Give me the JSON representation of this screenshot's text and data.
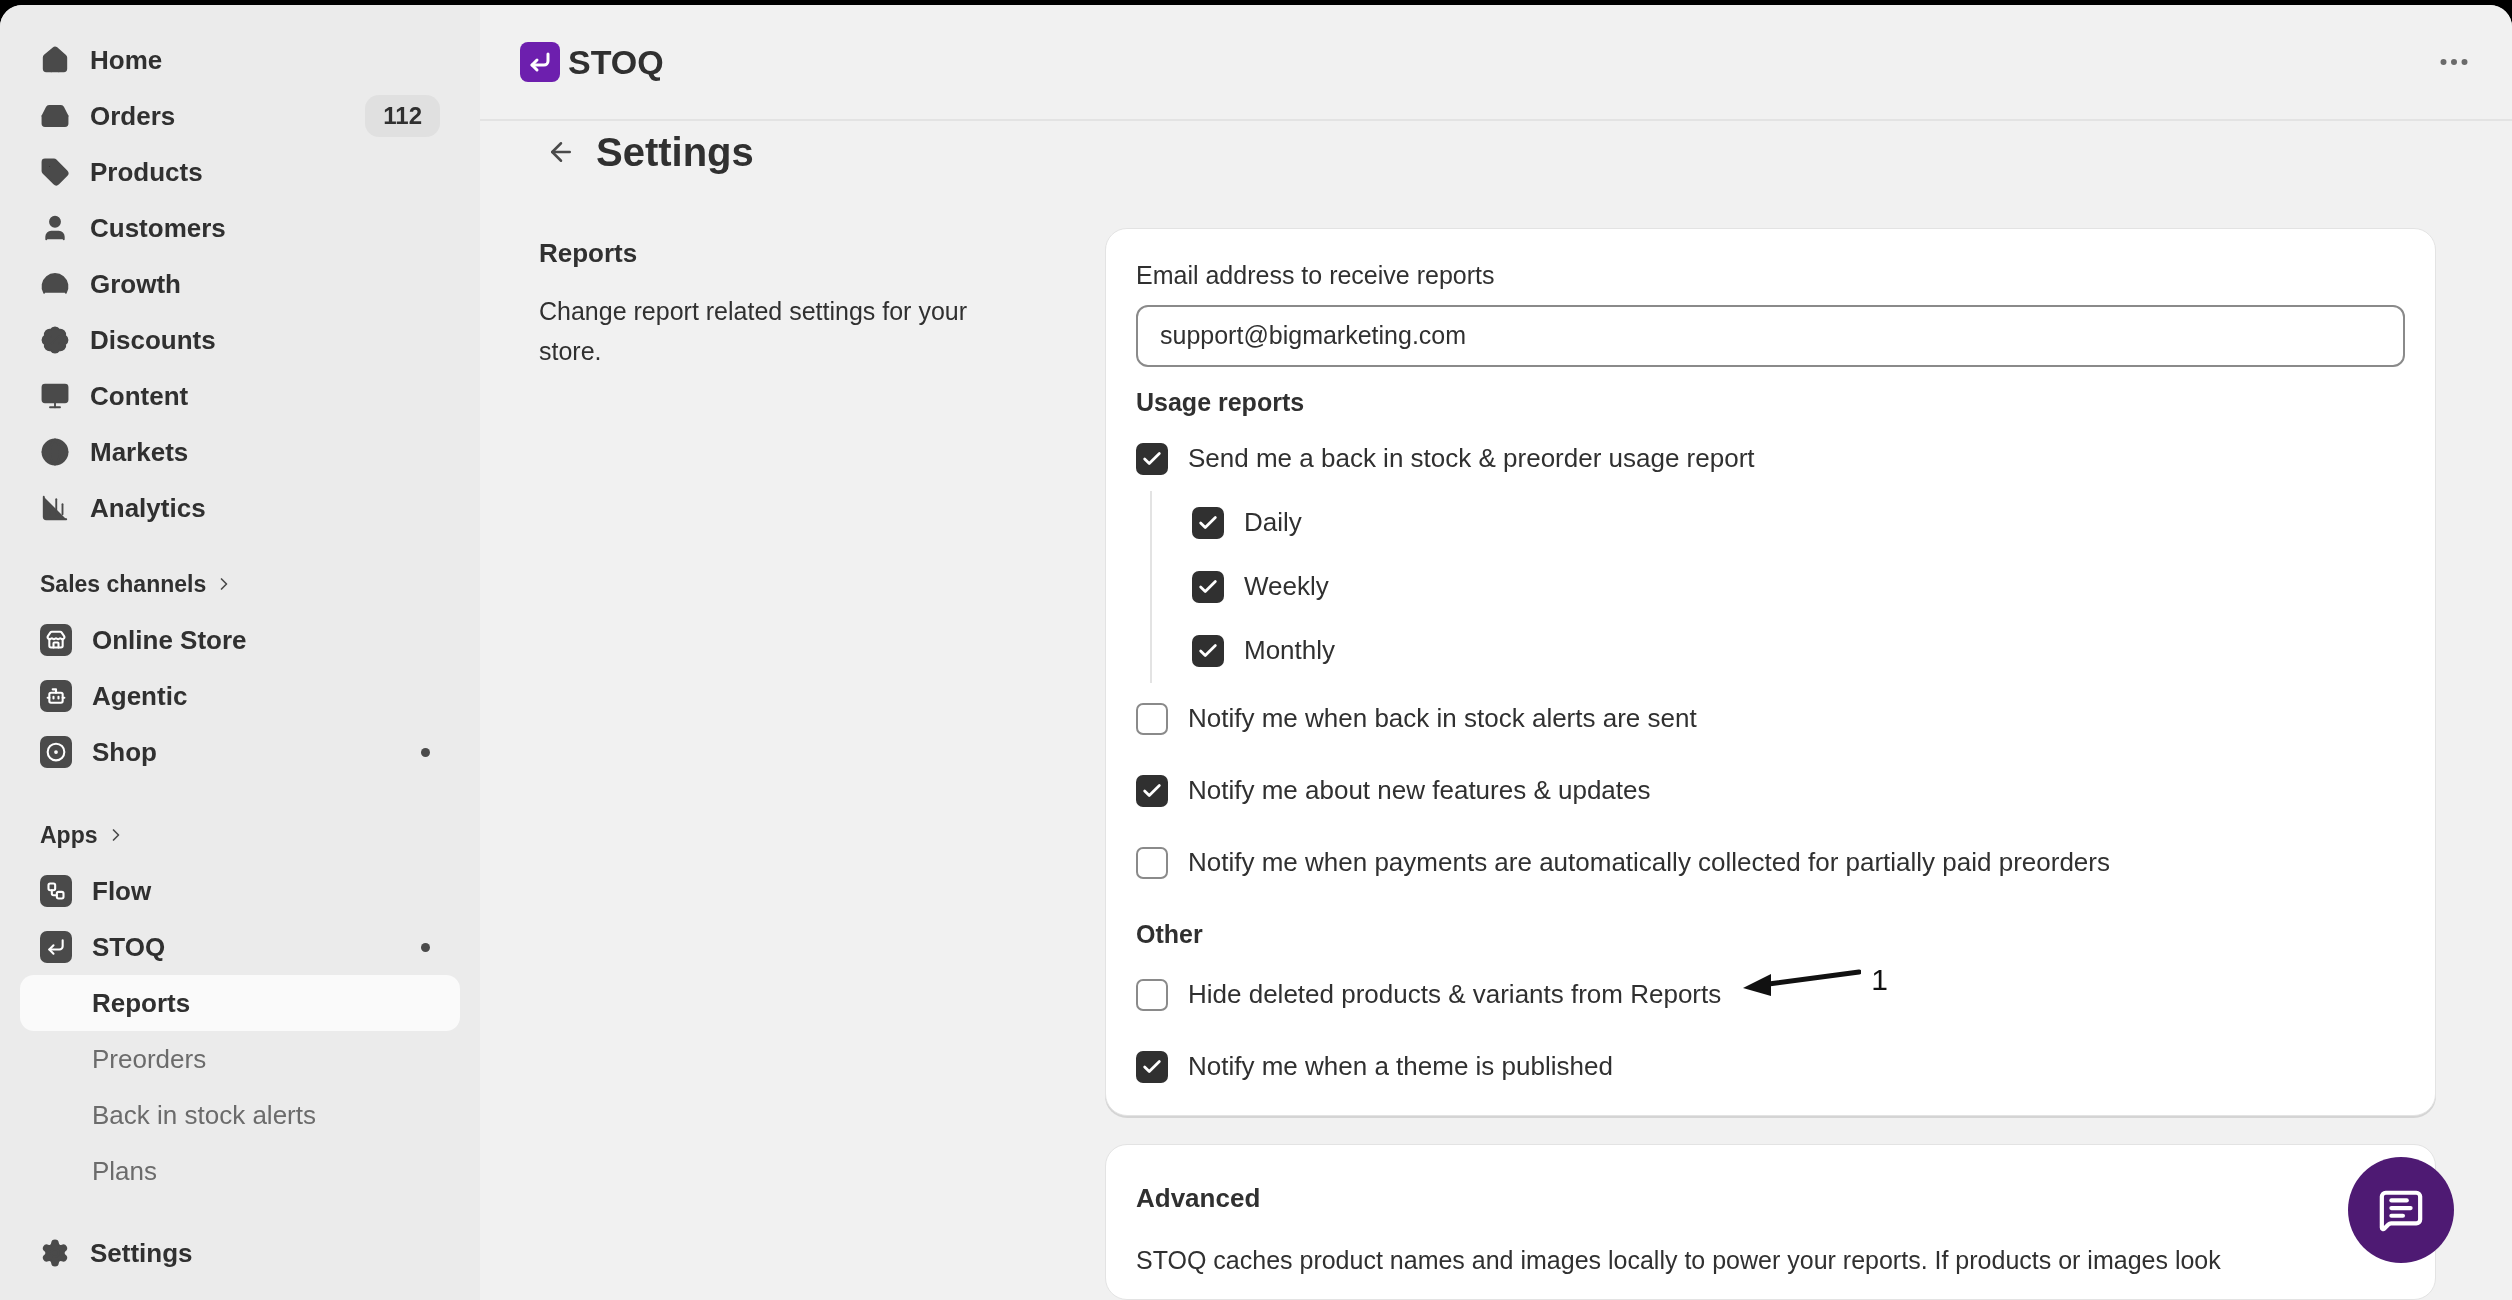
{
  "sidebar": {
    "main_items": [
      {
        "label": "Home"
      },
      {
        "label": "Orders",
        "badge": "112"
      },
      {
        "label": "Products"
      },
      {
        "label": "Customers"
      },
      {
        "label": "Growth"
      },
      {
        "label": "Discounts"
      },
      {
        "label": "Content"
      },
      {
        "label": "Markets"
      },
      {
        "label": "Analytics"
      }
    ],
    "sales_channels": {
      "title": "Sales channels",
      "items": [
        {
          "label": "Online Store",
          "dot": false
        },
        {
          "label": "Agentic",
          "dot": false
        },
        {
          "label": "Shop",
          "dot": true
        }
      ]
    },
    "apps": {
      "title": "Apps",
      "items": [
        {
          "label": "Flow",
          "dot": false
        },
        {
          "label": "STOQ",
          "dot": true,
          "children": [
            {
              "label": "Reports",
              "selected": true
            },
            {
              "label": "Preorders",
              "selected": false
            },
            {
              "label": "Back in stock alerts",
              "selected": false
            },
            {
              "label": "Plans",
              "selected": false
            }
          ]
        }
      ]
    },
    "settings_item": {
      "label": "Settings"
    }
  },
  "header": {
    "app_name": "STOQ"
  },
  "page": {
    "title": "Settings",
    "section": {
      "title": "Reports",
      "description": "Change report related settings for your store."
    },
    "email": {
      "label": "Email address to receive reports",
      "value": "support@bigmarketing.com"
    },
    "groups": [
      {
        "title": "Usage reports",
        "options": [
          {
            "label": "Send me a back in stock & preorder usage report",
            "checked": true,
            "children": [
              {
                "label": "Daily",
                "checked": true
              },
              {
                "label": "Weekly",
                "checked": true
              },
              {
                "label": "Monthly",
                "checked": true
              }
            ]
          },
          {
            "label": "Notify me when back in stock alerts are sent",
            "checked": false
          },
          {
            "label": "Notify me about new features & updates",
            "checked": true
          },
          {
            "label": "Notify me when payments are automatically collected for partially paid preorders",
            "checked": false
          }
        ]
      },
      {
        "title": "Other",
        "options": [
          {
            "label": "Hide deleted products & variants from Reports",
            "checked": false,
            "annotation": "1"
          },
          {
            "label": "Notify me when a theme is published",
            "checked": true
          }
        ]
      }
    ],
    "advanced": {
      "title": "Advanced",
      "text": "STOQ caches product names and images locally to power your reports. If products or images look"
    }
  }
}
